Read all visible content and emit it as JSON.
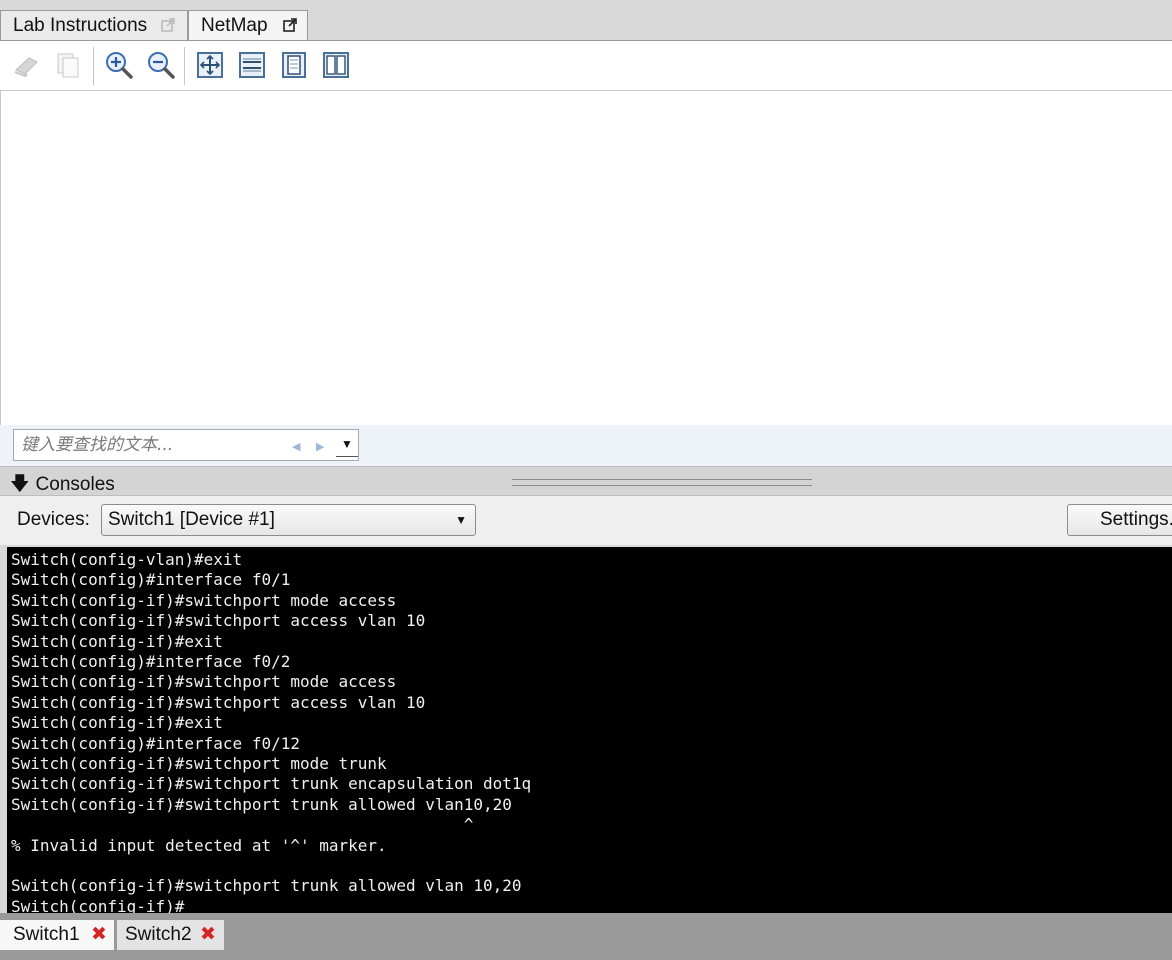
{
  "top_tabs": [
    {
      "label": "Lab Instructions",
      "icon": "external-link-icon",
      "active": false
    },
    {
      "label": "NetMap",
      "icon": "external-link-icon",
      "active": true
    }
  ],
  "toolbar": {
    "buttons": [
      {
        "name": "print-icon",
        "enabled": false
      },
      {
        "name": "copy-icon",
        "enabled": false
      },
      {
        "name": "zoom-in-icon",
        "enabled": true
      },
      {
        "name": "zoom-out-icon",
        "enabled": true
      },
      {
        "name": "fit-to-page-icon",
        "enabled": true
      },
      {
        "name": "fit-to-width-icon",
        "enabled": true
      },
      {
        "name": "single-page-icon",
        "enabled": true
      },
      {
        "name": "two-page-icon",
        "enabled": true
      }
    ]
  },
  "find": {
    "placeholder": "键入要查找的文本...",
    "prev": "◀",
    "next": "▶",
    "dropdown": "▼"
  },
  "consoles": {
    "title": "Consoles",
    "arrow": "🡇",
    "devices_label": "Devices:",
    "selected_device": "Switch1 [Device #1]",
    "settings_label": "Settings..."
  },
  "terminal": {
    "lines": [
      "Switch(config-vlan)#exit",
      "Switch(config)#interface f0/1",
      "Switch(config-if)#switchport mode access",
      "Switch(config-if)#switchport access vlan 10",
      "Switch(config-if)#exit",
      "Switch(config)#interface f0/2",
      "Switch(config-if)#switchport mode access",
      "Switch(config-if)#switchport access vlan 10",
      "Switch(config-if)#exit",
      "Switch(config)#interface f0/12",
      "Switch(config-if)#switchport mode trunk",
      "Switch(config-if)#switchport trunk encapsulation dot1q",
      "Switch(config-if)#switchport trunk allowed vlan10,20",
      "                                               ^",
      "% Invalid input detected at '^' marker.",
      "",
      "Switch(config-if)#switchport trunk allowed vlan 10,20",
      "Switch(config-if)#"
    ]
  },
  "bottom_tabs": [
    {
      "label": "Switch1",
      "close": "✖",
      "active": true
    },
    {
      "label": "Switch2",
      "close": "✖",
      "active": false
    }
  ],
  "colors": {
    "terminal_bg": "#000000",
    "terminal_fg": "#f0f0f0",
    "close_red": "#d42424",
    "find_bar_bg": "#eef3fa"
  }
}
